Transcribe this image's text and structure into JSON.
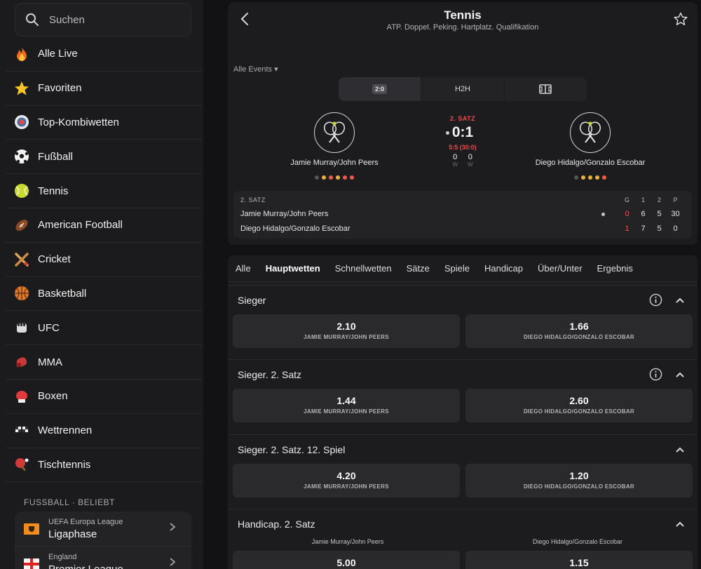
{
  "search": {
    "placeholder": "Suchen"
  },
  "sidebar": {
    "items": [
      {
        "label": "Alle Live",
        "icon": "fire-icon"
      },
      {
        "label": "Favoriten",
        "icon": "star-icon"
      },
      {
        "label": "Top-Kombiwetten",
        "icon": "target-icon"
      },
      {
        "label": "Fußball",
        "icon": "soccer-ball-icon"
      },
      {
        "label": "Tennis",
        "icon": "tennis-ball-icon"
      },
      {
        "label": "American Football",
        "icon": "american-football-icon"
      },
      {
        "label": "Cricket",
        "icon": "cricket-icon"
      },
      {
        "label": "Basketball",
        "icon": "basketball-icon"
      },
      {
        "label": "UFC",
        "icon": "ufc-icon"
      },
      {
        "label": "MMA",
        "icon": "mma-glove-icon"
      },
      {
        "label": "Boxen",
        "icon": "boxing-glove-icon"
      },
      {
        "label": "Wettrennen",
        "icon": "checkered-flag-icon"
      },
      {
        "label": "Tischtennis",
        "icon": "table-tennis-icon"
      }
    ],
    "section_title": "FUSSBALL · BELIEBT",
    "leagues": [
      {
        "sub": "UEFA Europa League",
        "name": "Ligaphase"
      },
      {
        "sub": "England",
        "name": "Premier League"
      }
    ]
  },
  "header": {
    "title": "Tennis",
    "subtitle": "ATP. Doppel. Peking. Hartplatz. Qualifikation"
  },
  "events_label": "Alle Events",
  "view_tabs": {
    "score": "2:0",
    "h2h": "H2H",
    "field": ""
  },
  "match": {
    "home": "Jamie Murray/John Peers",
    "away": "Diego Hidalgo/Gonzalo Escobar",
    "set_label": "2. SATZ",
    "score": "0:1",
    "game_score": "5:5 (30:0)",
    "home_w": "0",
    "away_w": "0",
    "w_label": "W",
    "home_form": [
      "#555558",
      "#e8b13a",
      "#ee5a4a",
      "#e8b13a",
      "#ee5a4a",
      "#ee5a4a"
    ],
    "away_form": [
      "#555558",
      "#e8b13a",
      "#e8b13a",
      "#e8b13a",
      "#ee5a4a"
    ]
  },
  "score_table": {
    "head": "2. SATZ",
    "cols": [
      "G",
      "1",
      "2",
      "P"
    ],
    "rows": [
      {
        "name": "Jamie Murray/John Peers",
        "g": "0",
        "s1": "6",
        "s2": "5",
        "p": "30"
      },
      {
        "name": "Diego Hidalgo/Gonzalo Escobar",
        "g": "1",
        "s1": "7",
        "s2": "5",
        "p": "0"
      }
    ]
  },
  "market_tabs": [
    "Alle",
    "Hauptwetten",
    "Schnellwetten",
    "Sätze",
    "Spiele",
    "Handicap",
    "Über/Unter",
    "Ergebnis"
  ],
  "markets": [
    {
      "title": "Sieger",
      "home_odd": "2.10",
      "away_odd": "1.66",
      "home_label": "JAMIE MURRAY/JOHN PEERS",
      "away_label": "DIEGO HIDALGO/GONZALO ESCOBAR"
    },
    {
      "title": "Sieger. 2. Satz",
      "home_odd": "1.44",
      "away_odd": "2.60",
      "home_label": "JAMIE MURRAY/JOHN PEERS",
      "away_label": "DIEGO HIDALGO/GONZALO ESCOBAR"
    },
    {
      "title": "Sieger. 2. Satz. 12. Spiel",
      "home_odd": "4.20",
      "away_odd": "1.20",
      "home_label": "JAMIE MURRAY/JOHN PEERS",
      "away_label": "DIEGO HIDALGO/GONZALO ESCOBAR"
    },
    {
      "title": "Handicap. 2. Satz",
      "home_name": "Jamie Murray/John Peers",
      "away_name": "Diego Hidalgo/Gonzalo Escobar",
      "home_odd": "5.00",
      "away_odd": "1.15"
    }
  ]
}
